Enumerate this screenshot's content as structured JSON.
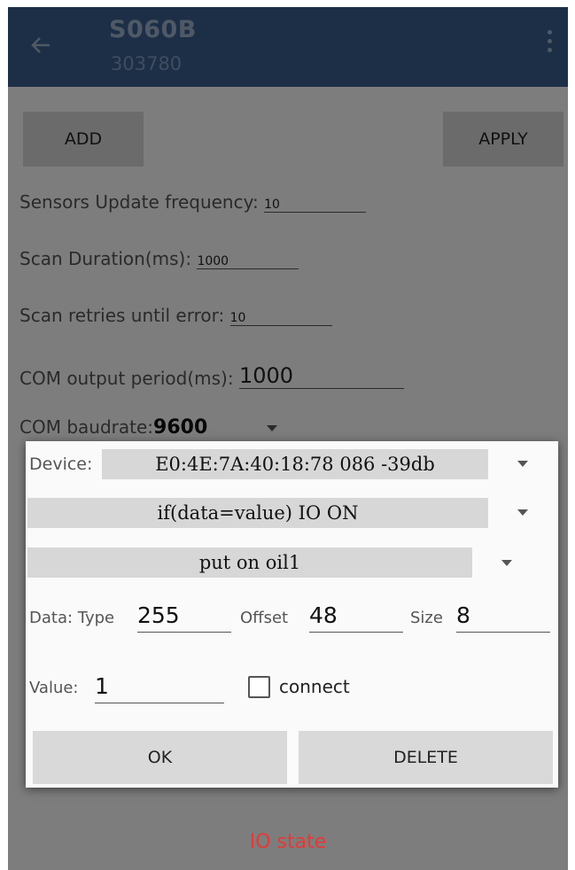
{
  "appbar": {
    "title": "S060B",
    "subtitle": "303780",
    "back_icon": "arrow-back-icon",
    "menu_icon": "kebab-menu-icon"
  },
  "actions": {
    "add": "ADD",
    "apply": "APPLY"
  },
  "settings": {
    "sensors_update_label": "Sensors Update frequency:",
    "sensors_update_value": "10",
    "scan_duration_label": "Scan Duration(ms):",
    "scan_duration_value": "1000",
    "scan_retries_label": "Scan retries until error:",
    "scan_retries_value": "10",
    "com_output_label": "COM output period(ms):",
    "com_output_value": "1000",
    "com_baudrate_label": "COM baudrate:",
    "com_baudrate_value": "9600"
  },
  "footer": {
    "io_state": "IO state"
  },
  "dialog": {
    "device_label": "Device:",
    "device_value": "E0:4E:7A:40:18:78 086 -39db",
    "condition_value": "if(data=value) IO ON",
    "action_value": "put on oil1",
    "data_type_label": "Data: Type",
    "data_type_value": "255",
    "offset_label": "Offset",
    "offset_value": "48",
    "size_label": "Size",
    "size_value": "8",
    "value_label": "Value:",
    "value_value": "1",
    "connect_label": "connect",
    "connect_checked": false,
    "ok_label": "OK",
    "delete_label": "DELETE"
  },
  "colors": {
    "appbar": "#3b5f8e",
    "io_state": "#e53935",
    "scrim": "rgba(0,0,0,0.5)"
  }
}
